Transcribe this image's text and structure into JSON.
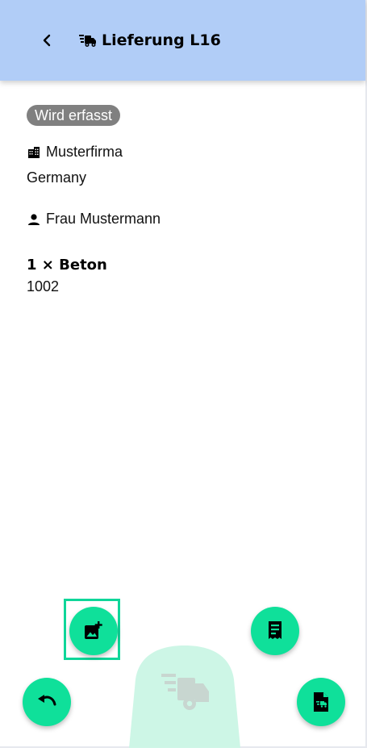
{
  "header": {
    "title": "Lieferung L16",
    "back_icon": "chevron-left-icon",
    "title_icon": "fast-truck-icon",
    "background": "#b1cdf7"
  },
  "status": {
    "label": "Wird erfasst",
    "color": "#808080"
  },
  "company": {
    "name": "Musterfirma",
    "country": "Germany",
    "icon": "building-icon"
  },
  "contact": {
    "name": "Frau Mustermann",
    "icon": "person-icon"
  },
  "item": {
    "title": "1 × Beton",
    "number": "1002"
  },
  "actions": {
    "add_photo_icon": "add-photo-icon",
    "receipt_icon": "receipt-icon",
    "undo_icon": "undo-icon",
    "document_icon": "document-truck-icon",
    "main_icon": "fast-truck-icon",
    "accent": "#0fe09a",
    "main_tab_color": "#cdf6e6"
  }
}
